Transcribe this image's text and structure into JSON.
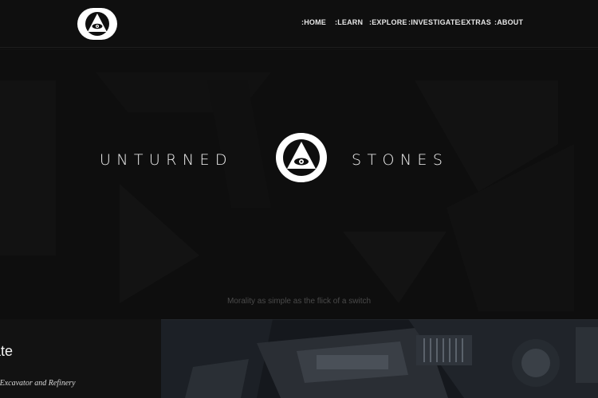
{
  "header": {
    "logo_icon": "eye-triangle-icon",
    "nav": [
      {
        "label": ":HOME"
      },
      {
        "label": ":LEARN"
      },
      {
        "label": ":EXPLORE"
      },
      {
        "label": ":INVESTIGATE"
      },
      {
        "label": ":EXTRAS"
      },
      {
        "label": ":ABOUT"
      }
    ]
  },
  "hero": {
    "brand_left": "UNTURNED",
    "brand_right": "STONES",
    "logo_icon": "eye-triangle-icon",
    "tagline": "Morality as simple as the flick of a switch"
  },
  "feature": {
    "title": "ate",
    "subtitle": "strial Excavator and Refinery"
  },
  "colors": {
    "background": "#0b0b0b",
    "header": "#0f0f0f",
    "text": "#ffffff",
    "muted": "#4a4a4a"
  }
}
